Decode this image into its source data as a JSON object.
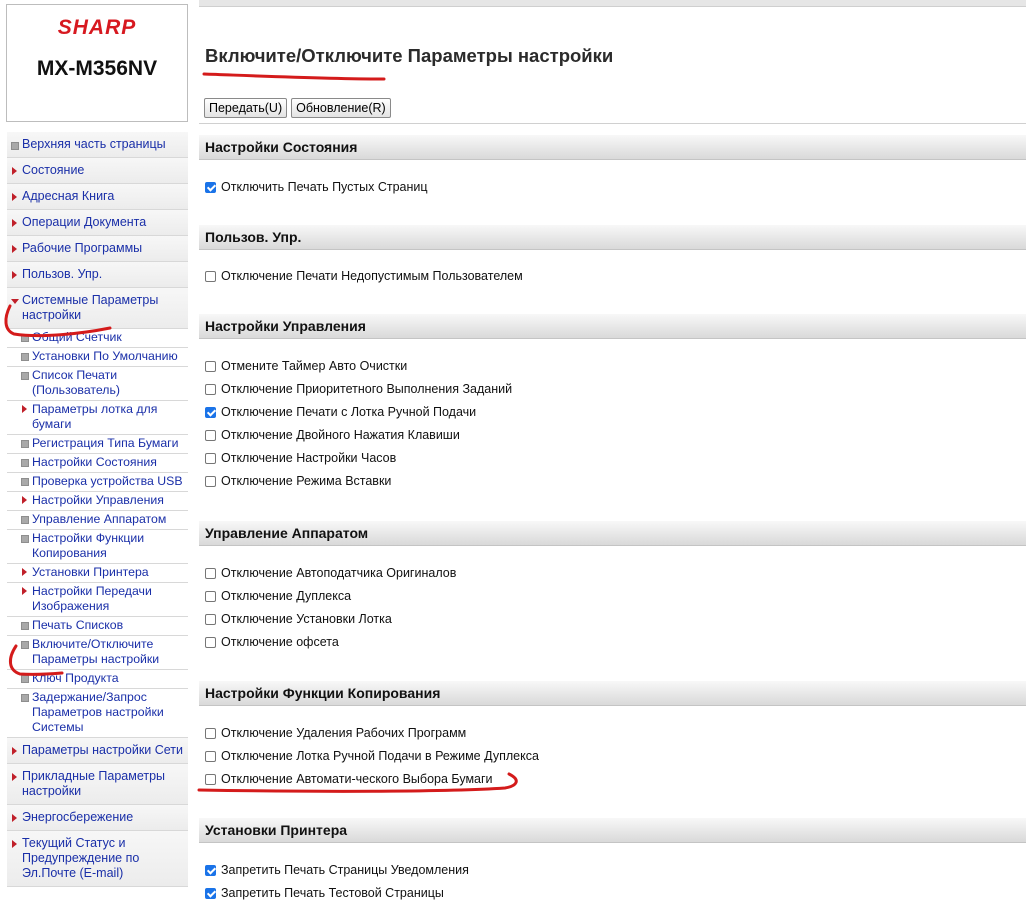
{
  "logo": {
    "brand": "SHARP",
    "model": "MX-M356NV"
  },
  "nav": [
    {
      "label": "Верхняя часть страницы",
      "level": "top",
      "marker": "square"
    },
    {
      "label": "Состояние",
      "level": "top",
      "marker": "triangle-right"
    },
    {
      "label": "Адресная Книга",
      "level": "top",
      "marker": "triangle-right"
    },
    {
      "label": "Операции Документа",
      "level": "top",
      "marker": "triangle-right"
    },
    {
      "label": "Рабочие Программы",
      "level": "top",
      "marker": "triangle-right"
    },
    {
      "label": "Пользов. Упр.",
      "level": "top",
      "marker": "triangle-right"
    },
    {
      "label": "Системные Параметры настройки",
      "level": "top",
      "marker": "triangle-down"
    },
    {
      "label": "Общий Счетчик",
      "level": "sub",
      "marker": "square"
    },
    {
      "label": "Установки По Умолчанию",
      "level": "sub",
      "marker": "square"
    },
    {
      "label": "Список Печати (Пользователь)",
      "level": "sub",
      "marker": "square"
    },
    {
      "label": "Параметры лотка для бумаги",
      "level": "sub",
      "marker": "triangle-right"
    },
    {
      "label": "Регистрация Типа Бумаги",
      "level": "sub",
      "marker": "square"
    },
    {
      "label": "Настройки Состояния",
      "level": "sub",
      "marker": "square"
    },
    {
      "label": "Проверка устройства USB",
      "level": "sub",
      "marker": "square"
    },
    {
      "label": "Настройки Управления",
      "level": "sub",
      "marker": "triangle-right"
    },
    {
      "label": "Управление Аппаратом",
      "level": "sub",
      "marker": "square"
    },
    {
      "label": "Настройки Функции Копирования",
      "level": "sub",
      "marker": "square"
    },
    {
      "label": "Установки Принтера",
      "level": "sub",
      "marker": "triangle-right"
    },
    {
      "label": "Настройки Передачи Изображения",
      "level": "sub",
      "marker": "triangle-right"
    },
    {
      "label": "Печать Списков",
      "level": "sub",
      "marker": "square"
    },
    {
      "label": "Включите/Отключите Параметры настройки",
      "level": "sub",
      "marker": "square"
    },
    {
      "label": "Ключ Продукта",
      "level": "sub",
      "marker": "square"
    },
    {
      "label": "Задержание/Запрос Параметров настройки Системы",
      "level": "sub",
      "marker": "square"
    },
    {
      "label": "Параметры настройки Сети",
      "level": "top",
      "marker": "triangle-right"
    },
    {
      "label": "Прикладные Параметры настройки",
      "level": "top",
      "marker": "triangle-right"
    },
    {
      "label": "Энергосбережение",
      "level": "top",
      "marker": "triangle-right"
    },
    {
      "label": "Текущий Статус и Предупреждение по Эл.Почте (E-mail)",
      "level": "top",
      "marker": "triangle-right"
    }
  ],
  "main": {
    "title": "Включите/Отключите Параметры настройки",
    "buttons": {
      "submit": "Передать(U)",
      "update": "Обновление(R)"
    },
    "sections": [
      {
        "title": "Настройки Состояния",
        "items": [
          {
            "label": "Отключить Печать Пустых Страниц",
            "checked": true
          }
        ]
      },
      {
        "title": "Пользов. Упр.",
        "items": [
          {
            "label": "Отключение Печати Недопустимым Пользователем",
            "checked": false
          }
        ]
      },
      {
        "title": "Настройки Управления",
        "items": [
          {
            "label": "Отмените Таймер Авто Очистки",
            "checked": false
          },
          {
            "label": "Отключение Приоритетного Выполнения Заданий",
            "checked": false
          },
          {
            "label": "Отключение Печати с Лотка Ручной Подачи",
            "checked": true
          },
          {
            "label": "Отключение Двойного Нажатия Клавиши",
            "checked": false
          },
          {
            "label": "Отключение Настройки Часов",
            "checked": false
          },
          {
            "label": "Отключение Режима Вставки",
            "checked": false
          }
        ]
      },
      {
        "title": "Управление Аппаратом",
        "items": [
          {
            "label": "Отключение Автоподатчика Оригиналов",
            "checked": false
          },
          {
            "label": "Отключение Дуплекса",
            "checked": false
          },
          {
            "label": "Отключение Установки Лотка",
            "checked": false
          },
          {
            "label": "Отключение офсета",
            "checked": false
          }
        ]
      },
      {
        "title": "Настройки Функции Копирования",
        "items": [
          {
            "label": "Отключение Удаления Рабочих Программ",
            "checked": false
          },
          {
            "label": "Отключение Лотка Ручной Подачи в Режиме Дуплекса",
            "checked": false
          },
          {
            "label": "Отключение Автомати-ческого Выбора Бумаги",
            "checked": false
          }
        ]
      },
      {
        "title": "Установки Принтера",
        "items": [
          {
            "label": "Запретить Печать Страницы Уведомления",
            "checked": true
          },
          {
            "label": "Запретить Печать Тестовой Страницы",
            "checked": true
          }
        ]
      }
    ]
  },
  "colors": {
    "brand_red": "#d71920",
    "link_blue": "#1a2fa8",
    "checkbox_blue": "#1a73e8",
    "pen_red": "#d41b1b"
  }
}
